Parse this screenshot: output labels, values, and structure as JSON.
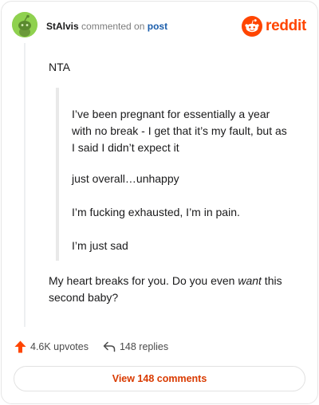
{
  "header": {
    "username": "StAlvis",
    "commented_text": "commented on",
    "post_link": "post",
    "brand": "reddit"
  },
  "comment": {
    "first_line": "NTA",
    "quote": [
      "I’ve been pregnant for essentially a year with no break - I get that it’s my fault, but as I said I didn’t expect it",
      "just overall…unhappy",
      "I’m fucking exhausted, I’m in pain.",
      "I’m just sad"
    ],
    "reply_before": "My heart breaks for you. Do you even ",
    "reply_emphasis": "want",
    "reply_after": " this second baby?"
  },
  "actions": {
    "upvotes": "4.6K upvotes",
    "replies": "148 replies"
  },
  "view_comments_label": "View 148 comments",
  "colors": {
    "brand": "#ff4500",
    "link": "#1a5dab",
    "upvote": "#ff4500",
    "view_button_text": "#d93a00"
  }
}
